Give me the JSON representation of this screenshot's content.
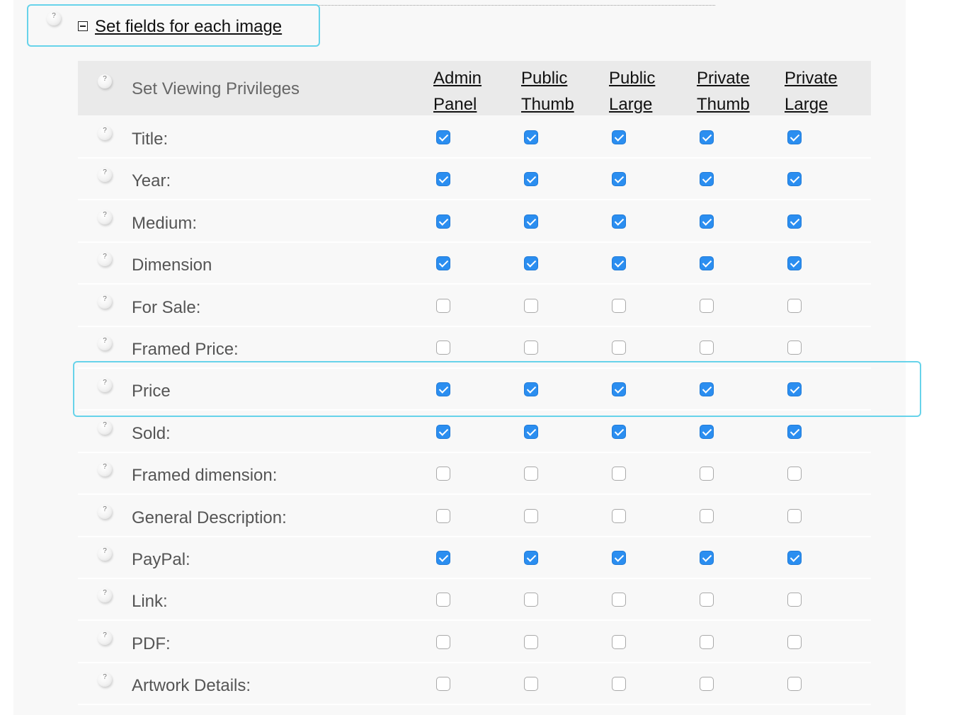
{
  "section": {
    "title": "Set fields for each image",
    "help_glyph": "?",
    "collapse_icon": "minus-square-icon"
  },
  "table": {
    "header_label": "Set Viewing Privileges",
    "columns": [
      {
        "line1": "Admin",
        "line2": "Panel"
      },
      {
        "line1": "Public",
        "line2": "Thumb"
      },
      {
        "line1": "Public",
        "line2": "Large"
      },
      {
        "line1": "Private",
        "line2": "Thumb"
      },
      {
        "line1": "Private",
        "line2": "Large"
      }
    ],
    "rows": [
      {
        "label": "Title:",
        "checks": [
          true,
          true,
          true,
          true,
          true
        ]
      },
      {
        "label": "Year:",
        "checks": [
          true,
          true,
          true,
          true,
          true
        ]
      },
      {
        "label": "Medium:",
        "checks": [
          true,
          true,
          true,
          true,
          true
        ]
      },
      {
        "label": "Dimension",
        "checks": [
          true,
          true,
          true,
          true,
          true
        ]
      },
      {
        "label": "For Sale:",
        "checks": [
          false,
          false,
          false,
          false,
          false
        ]
      },
      {
        "label": "Framed Price:",
        "checks": [
          false,
          false,
          false,
          false,
          false
        ]
      },
      {
        "label": "Price",
        "checks": [
          true,
          true,
          true,
          true,
          true
        ]
      },
      {
        "label": "Sold:",
        "checks": [
          true,
          true,
          true,
          true,
          true
        ]
      },
      {
        "label": "Framed dimension:",
        "checks": [
          false,
          false,
          false,
          false,
          false
        ]
      },
      {
        "label": "General Description:",
        "checks": [
          false,
          false,
          false,
          false,
          false
        ]
      },
      {
        "label": "PayPal:",
        "checks": [
          true,
          true,
          true,
          true,
          true
        ]
      },
      {
        "label": "Link:",
        "checks": [
          false,
          false,
          false,
          false,
          false
        ]
      },
      {
        "label": "PDF:",
        "checks": [
          false,
          false,
          false,
          false,
          false
        ]
      },
      {
        "label": "Artwork Details:",
        "checks": [
          false,
          false,
          false,
          false,
          false
        ]
      }
    ]
  },
  "colors": {
    "accent_highlight": "#67d3ea",
    "checkbox_checked": "#2b8ef0",
    "header_background": "#eaeaea",
    "panel_background": "#f8f8f8"
  }
}
